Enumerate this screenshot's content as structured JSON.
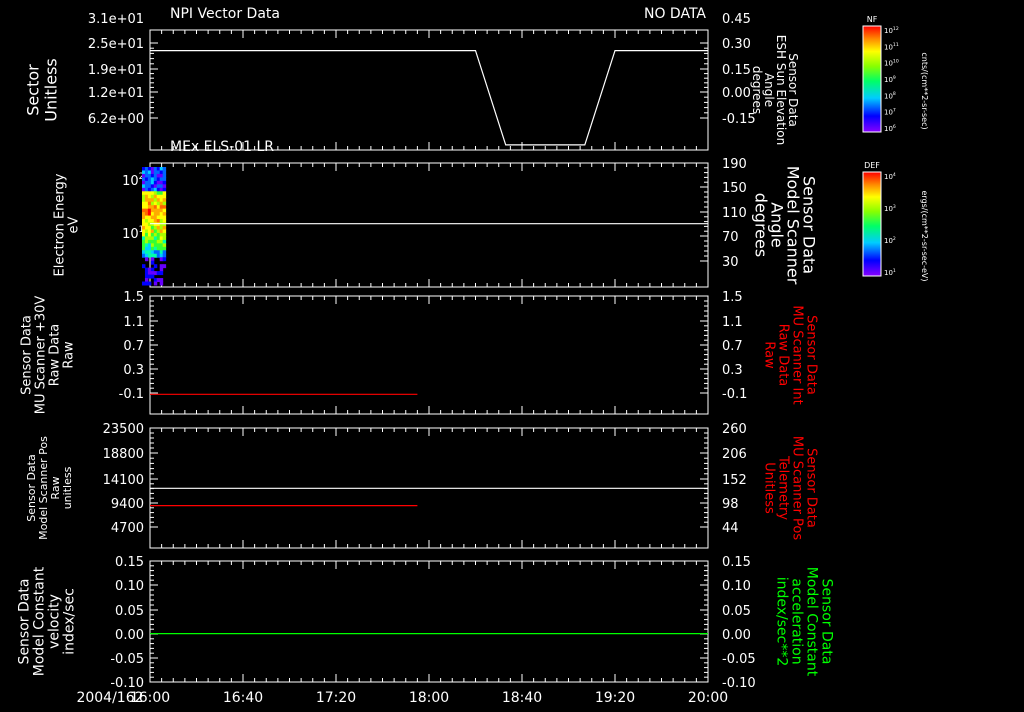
{
  "time_axis": {
    "date_label": "2004/162",
    "ticks": [
      "16:00",
      "16:40",
      "17:20",
      "18:00",
      "18:40",
      "19:20",
      "20:00"
    ],
    "minor_per_major": 8
  },
  "colors": {
    "background": "#000000",
    "foreground": "#ffffff",
    "red": "#ff0000",
    "green": "#00ff00"
  },
  "chart_data": [
    {
      "type": "line",
      "id": "p1",
      "title": "NPI Vector Data",
      "note": "NO DATA",
      "left_label": [
        "Sector",
        "Unitless"
      ],
      "left_ticks": [
        "3.1e+01",
        "2.5e+01",
        "1.9e+01",
        "1.2e+01",
        "6.2e+00"
      ],
      "right_label": [
        "Sensor Data",
        "ESH Sun Elevation",
        "Angle",
        "degrees"
      ],
      "right_ticks": [
        "0.45",
        "0.30",
        "0.15",
        "0.00",
        "-0.15"
      ],
      "right_ylim": [
        -0.25,
        0.45
      ],
      "series": [
        {
          "axis": "right",
          "color": "#ffffff",
          "points": [
            [
              "16:00",
              0.33
            ],
            [
              "18:20",
              0.33
            ],
            [
              "18:33",
              -0.22
            ],
            [
              "19:07",
              -0.22
            ],
            [
              "19:20",
              0.33
            ],
            [
              "20:00",
              0.33
            ]
          ]
        }
      ],
      "colorbar": {
        "title": "NF",
        "ticks": [
          "10^12",
          "10^11",
          "10^10",
          "10^9",
          "10^8",
          "10^7",
          "10^6"
        ],
        "units": "cnts/(cm**2-sr-sec)"
      }
    },
    {
      "type": "heatmap",
      "id": "p2",
      "title": "MEx ELS-01 LR",
      "left_label": [
        "Electron Energy",
        "eV"
      ],
      "left_ticks": [
        "10^2",
        "10^1"
      ],
      "left_ylim_log10": [
        0.0,
        2.3
      ],
      "right_label": [
        "Sensor Data",
        "Model Scanner",
        "Angle",
        "degrees"
      ],
      "right_ticks": [
        "190",
        "150",
        "110",
        "70",
        "30"
      ],
      "right_ylim": [
        0,
        190
      ],
      "spectrogram_time": [
        "16:00",
        "16:05"
      ],
      "series": [
        {
          "axis": "right",
          "color": "#ffffff",
          "points": [
            [
              "16:00",
              97
            ],
            [
              "20:00",
              97
            ]
          ]
        }
      ],
      "colorbar": {
        "title": "DEF",
        "ticks": [
          "10^4",
          "10^3",
          "10^2",
          "10^1"
        ],
        "units": "ergs/(cm**2-sr-sec-eV)"
      }
    },
    {
      "type": "line",
      "id": "p3",
      "left_label": [
        "Sensor Data",
        "MU Scanner +30V",
        "Raw Data",
        "Raw"
      ],
      "left_ticks": [
        "1.5",
        "1.1",
        "0.7",
        "0.3",
        "-0.1"
      ],
      "ylim": [
        -0.3,
        1.5
      ],
      "right_label": [
        "Sensor Data",
        "MU Scanner Int",
        "Raw Data",
        "Raw"
      ],
      "right_ticks": [
        "1.5",
        "1.1",
        "0.7",
        "0.3",
        "-0.1"
      ],
      "right_ylim": [
        -0.3,
        1.5
      ],
      "series": [
        {
          "axis": "left",
          "color": "#ff0000",
          "points": [
            [
              "16:00",
              0.0
            ],
            [
              "17:55",
              0.0
            ]
          ]
        }
      ]
    },
    {
      "type": "line",
      "id": "p4",
      "left_label": [
        "Sensor Data",
        "Model Scanner Pos",
        "Raw",
        "unitless"
      ],
      "left_ticks": [
        "23500",
        "18800",
        "14100",
        "9400",
        "4700"
      ],
      "ylim": [
        0,
        23500
      ],
      "right_label": [
        "Sensor Data",
        "MU Scanner Pos",
        "Telemetry",
        "Unitless"
      ],
      "right_ticks": [
        "260",
        "206",
        "152",
        "98",
        "44"
      ],
      "right_ylim": [
        0,
        260
      ],
      "series": [
        {
          "axis": "left",
          "color": "#ffffff",
          "points": [
            [
              "16:00",
              11700
            ],
            [
              "20:00",
              11700
            ]
          ]
        },
        {
          "axis": "left",
          "color": "#ff0000",
          "points": [
            [
              "16:00",
              8300
            ],
            [
              "17:55",
              8300
            ]
          ]
        }
      ]
    },
    {
      "type": "line",
      "id": "p5",
      "left_label": [
        "Sensor Data",
        "Model Constant",
        "velocity",
        "index/sec"
      ],
      "left_ticks": [
        "0.15",
        "0.10",
        "0.05",
        "0.00",
        "-0.05",
        "-0.10"
      ],
      "ylim": [
        -0.1,
        0.15
      ],
      "right_label": [
        "Sensor Data",
        "Model Constant",
        "acceleration",
        "index/sec**2"
      ],
      "right_ticks": [
        "0.15",
        "0.10",
        "0.05",
        "0.00",
        "-0.05",
        "-0.10"
      ],
      "right_ylim": [
        -0.1,
        0.15
      ],
      "series": [
        {
          "axis": "left",
          "color": "#00ff00",
          "points": [
            [
              "16:00",
              0.0
            ],
            [
              "20:00",
              0.0
            ]
          ]
        }
      ]
    }
  ]
}
